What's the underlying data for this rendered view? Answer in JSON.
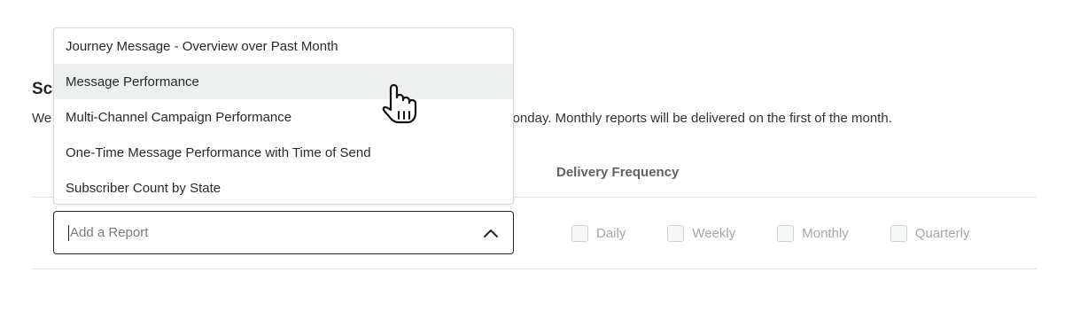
{
  "section": {
    "heading": "Sc",
    "description_start": "We",
    "description_end": "onday. Monthly reports will be delivered on the first of the month."
  },
  "table": {
    "delivery_frequency_header": "Delivery Frequency"
  },
  "report_select": {
    "placeholder": "Add a Report",
    "icon": "chevron-up-icon"
  },
  "dropdown": {
    "items": [
      {
        "label": "Journey Message - Overview over Past Month",
        "hovered": false
      },
      {
        "label": "Message Performance",
        "hovered": true
      },
      {
        "label": "Multi-Channel Campaign Performance",
        "hovered": false
      },
      {
        "label": "One-Time Message Performance with Time of Send",
        "hovered": false
      },
      {
        "label": "Subscriber Count by State",
        "hovered": false
      }
    ]
  },
  "frequency": {
    "options": [
      {
        "label": "Daily",
        "checked": false
      },
      {
        "label": "Weekly",
        "checked": false
      },
      {
        "label": "Monthly",
        "checked": false
      },
      {
        "label": "Quarterly",
        "checked": false
      }
    ]
  },
  "cursor": {
    "icon": "hand-pointer-icon"
  },
  "colors": {
    "text": "#1f2a2a",
    "hover_bg": "#eef0ef",
    "border_dark": "#1e2828",
    "muted": "#a2a8a8"
  }
}
